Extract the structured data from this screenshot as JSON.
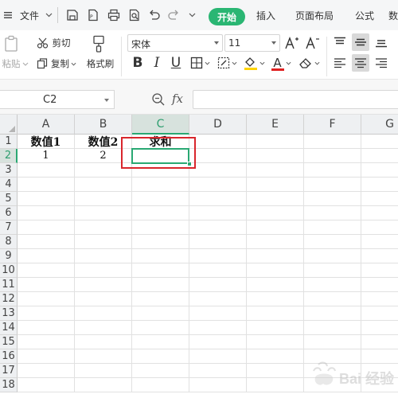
{
  "menubar": {
    "file_label": "文件",
    "tabs": [
      "开始",
      "插入",
      "页面布局",
      "公式",
      "数"
    ]
  },
  "ribbon": {
    "paste_label": "粘贴",
    "cut_label": "剪切",
    "copy_label": "复制",
    "format_painter_label": "格式刷",
    "font_name": "宋体",
    "font_size": "11",
    "bold": "B",
    "italic": "I",
    "underline": "U",
    "font_color_glyph": "A"
  },
  "formula_bar": {
    "name_box": "C2",
    "fx_label": "fx",
    "formula_value": ""
  },
  "sheet": {
    "columns": [
      "A",
      "B",
      "C",
      "D",
      "E",
      "F",
      "G"
    ],
    "rows": [
      "1",
      "2",
      "3",
      "4",
      "5",
      "6",
      "7",
      "8",
      "9",
      "10",
      "11",
      "12",
      "13",
      "14",
      "15",
      "16",
      "17",
      "18"
    ],
    "selected_column": "C",
    "selected_row": "2",
    "cells": {
      "A1": "数值1",
      "B1": "数值2",
      "C1": "求和",
      "A2": "1",
      "B2": "2"
    }
  },
  "colors": {
    "accent": "#2ab673",
    "selection": "#2aa873",
    "highlight_box": "#d9262c",
    "fill_color_bar": "#ffd400",
    "font_color_bar": "#e02020"
  },
  "watermark_text": "Bai 经验"
}
